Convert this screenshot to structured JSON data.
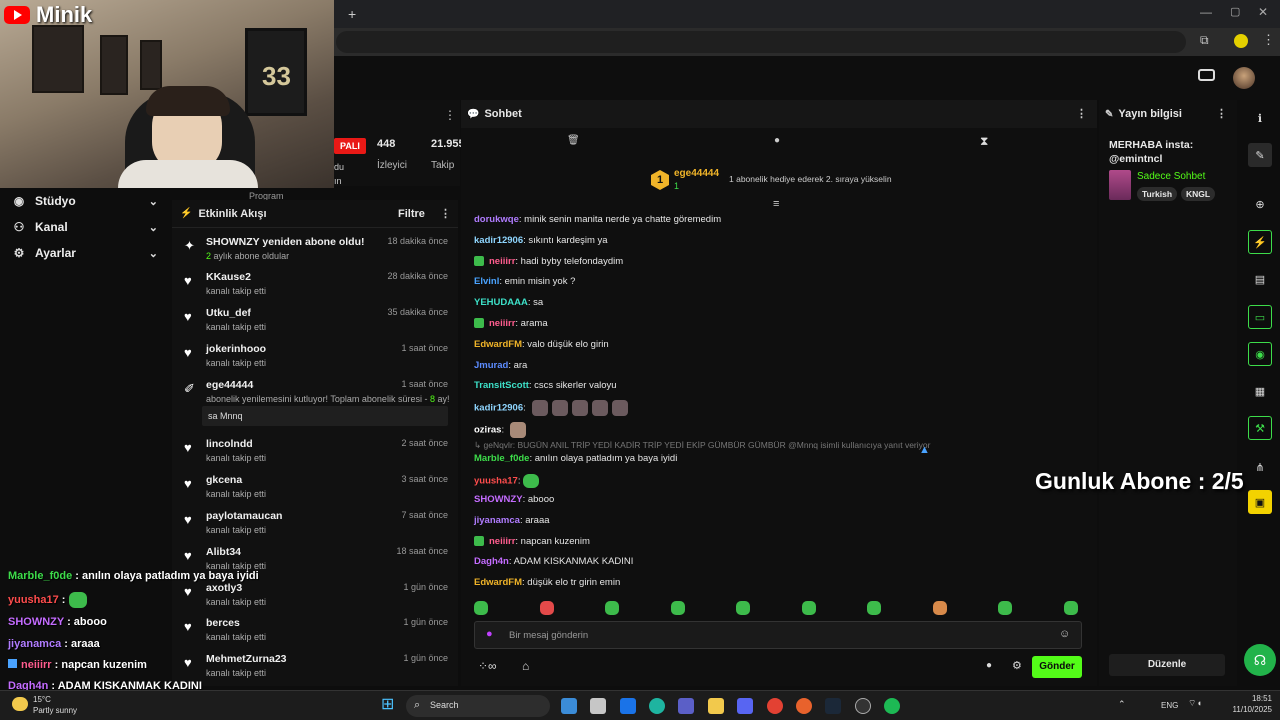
{
  "webcam": {
    "brand": "Minik"
  },
  "left_nav": [
    {
      "label": "Stüdyo",
      "icon": "broadcast-icon"
    },
    {
      "label": "Kanal",
      "icon": "users-icon"
    },
    {
      "label": "Ayarlar",
      "icon": "gear-icon"
    }
  ],
  "stats": {
    "badge": "PALI",
    "viewers_value": "448",
    "viewers_label": "İzleyici",
    "followers_value": "21.955",
    "followers_label": "Takip",
    "partial1": "du",
    "partial2": "ın",
    "program": "Program"
  },
  "activity": {
    "title": "Etkinlik Akışı",
    "filter": "Filtre",
    "items": [
      {
        "name": "SHOWNZY yeniden abone oldu!",
        "sub_num": "2",
        "sub": " aylık abone oldular",
        "time": "18 dakika önce",
        "icon": "sparkle-icon"
      },
      {
        "name": "KKause2",
        "sub": "kanalı takip etti",
        "time": "28 dakika önce",
        "icon": "heart-icon"
      },
      {
        "name": "Utku_def",
        "sub": "kanalı takip etti",
        "time": "35 dakika önce",
        "icon": "heart-icon"
      },
      {
        "name": "jokerinhooo",
        "sub": "kanalı takip etti",
        "time": "1 saat önce",
        "icon": "heart-icon"
      },
      {
        "name": "ege44444",
        "sub": "abonelik yenilemesini kutluyor! Toplam abonelik süresi - ",
        "sub_num": "8",
        "sub_tail": " ay!",
        "time": "1 saat önce",
        "icon": "party-icon",
        "message": "sa Mnnq"
      },
      {
        "name": "lincolndd",
        "sub": "kanalı takip etti",
        "time": "2 saat önce",
        "icon": "heart-icon"
      },
      {
        "name": "gkcena",
        "sub": "kanalı takip etti",
        "time": "3 saat önce",
        "icon": "heart-icon"
      },
      {
        "name": "paylotamaucan",
        "sub": "kanalı takip etti",
        "time": "7 saat önce",
        "icon": "heart-icon"
      },
      {
        "name": "Alibt34",
        "sub": "kanalı takip etti",
        "time": "18 saat önce",
        "icon": "heart-icon"
      },
      {
        "name": "axotly3",
        "sub": "kanalı takip etti",
        "time": "1 gün önce",
        "icon": "heart-icon"
      },
      {
        "name": "berces",
        "sub": "kanalı takip etti",
        "time": "1 gün önce",
        "icon": "heart-icon"
      },
      {
        "name": "MehmetZurna23",
        "sub": "kanalı takip etti",
        "time": "1 gün önce",
        "icon": "heart-icon"
      }
    ]
  },
  "chat": {
    "title": "Sohbet",
    "pinned_user": "ege44444",
    "pinned_count": "1",
    "pinned_note": "1 abonelik hediye ederek 2. sıraya yükselin",
    "messages": [
      {
        "user": "dorukwqe",
        "text": ": minik senin manita nerde ya chatte göremedim",
        "color": "#b07cff"
      },
      {
        "user": "kadir12906",
        "text": ": sıkıntı kardeşim ya",
        "color": "#8fd6ff"
      },
      {
        "user": "neiiirr",
        "text": ": hadi byby telefondaydim",
        "color": "#ff5d8f",
        "badge": true
      },
      {
        "user": "Elvinl",
        "text": ": emin misin yok ?",
        "color": "#4aa3ff"
      },
      {
        "user": "YEHUDAAA",
        "text": ": sa",
        "color": "#3de0c8"
      },
      {
        "user": "neiiirr",
        "text": ": arama",
        "color": "#ff5d8f",
        "badge": true
      },
      {
        "user": "EdwardFM",
        "text": ": valo düşük elo girin",
        "color": "#f0b429"
      },
      {
        "user": "Jmurad",
        "text": ": ara",
        "color": "#5c8cff"
      },
      {
        "user": "TransitScott",
        "text": ": cscs sikerler valoyu",
        "color": "#3de0c8"
      },
      {
        "user": "kadir12906",
        "text": ":",
        "color": "#8fd6ff",
        "emotes": 5
      },
      {
        "user": "oziras",
        "text": ":",
        "color": "#ffffff",
        "emotes": 1
      },
      {
        "user": "Marble_f0de",
        "text": ": anılın olaya patladım ya baya iyidi",
        "color": "#3ddc4a"
      },
      {
        "user": "yuusha17",
        "text": ":",
        "color": "#ff4d4d",
        "green_emote": true
      },
      {
        "user": "SHOWNZY",
        "text": ": abooo",
        "color": "#c46cff"
      },
      {
        "user": "jiyanamca",
        "text": ": araaa",
        "color": "#b07cff"
      },
      {
        "user": "neiiirr",
        "text": ": napcan kuzenim",
        "color": "#ff5d8f",
        "badge": true
      },
      {
        "user": "Dagh4n",
        "text": ": ADAM KISKANMAK KADINI",
        "color": "#c46cff"
      },
      {
        "user": "EdwardFM",
        "text": ": düşük elo tr girin emin",
        "color": "#f0b429"
      }
    ],
    "reply_note": "↳ geNqvlr: BUGÜN ANIL TRİP YEDİ KADİR TRİP YEDİ EKİP GÜMBÜR GÜMBÜR @Mnnq isimli kullanıcıya yanıt veriyor",
    "input_placeholder": "Bir mesaj gönderin",
    "send": "Gönder"
  },
  "info": {
    "title": "Yayın bilgisi",
    "stream_title": "MERHABA insta: @emintncl",
    "category": "Sadece Sohbet",
    "tags": [
      "Turkish",
      "KNGL"
    ],
    "edit": "Düzenle"
  },
  "overlay_chat": [
    {
      "user": "Marble_f0de",
      "text": " : anılın olaya patladım ya baya iyidi",
      "color": "#3ddc4a"
    },
    {
      "user": "yuusha17",
      "text": " :",
      "color": "#ff4d4d",
      "green_emote": true
    },
    {
      "user": "SHOWNZY",
      "text": " : abooo",
      "color": "#c46cff"
    },
    {
      "user": "jiyanamca",
      "text": " : araaa",
      "color": "#b07cff"
    },
    {
      "user": "neiiirr",
      "text": " : napcan kuzenim",
      "color": "#ff5d8f",
      "badge": true
    },
    {
      "user": "Dagh4n",
      "text": " : ADAM KISKANMAK KADINI",
      "color": "#c46cff"
    }
  ],
  "goal": "Gunluk Abone : 2/5",
  "taskbar": {
    "weather_temp": "15°C",
    "weather_text": "Partly sunny",
    "search": "Search",
    "lang": "ENG",
    "time": "18:51",
    "date": "11/10/2025"
  },
  "colors": {
    "accent_green": "#53fc18",
    "bg": "#0f0f0f"
  }
}
